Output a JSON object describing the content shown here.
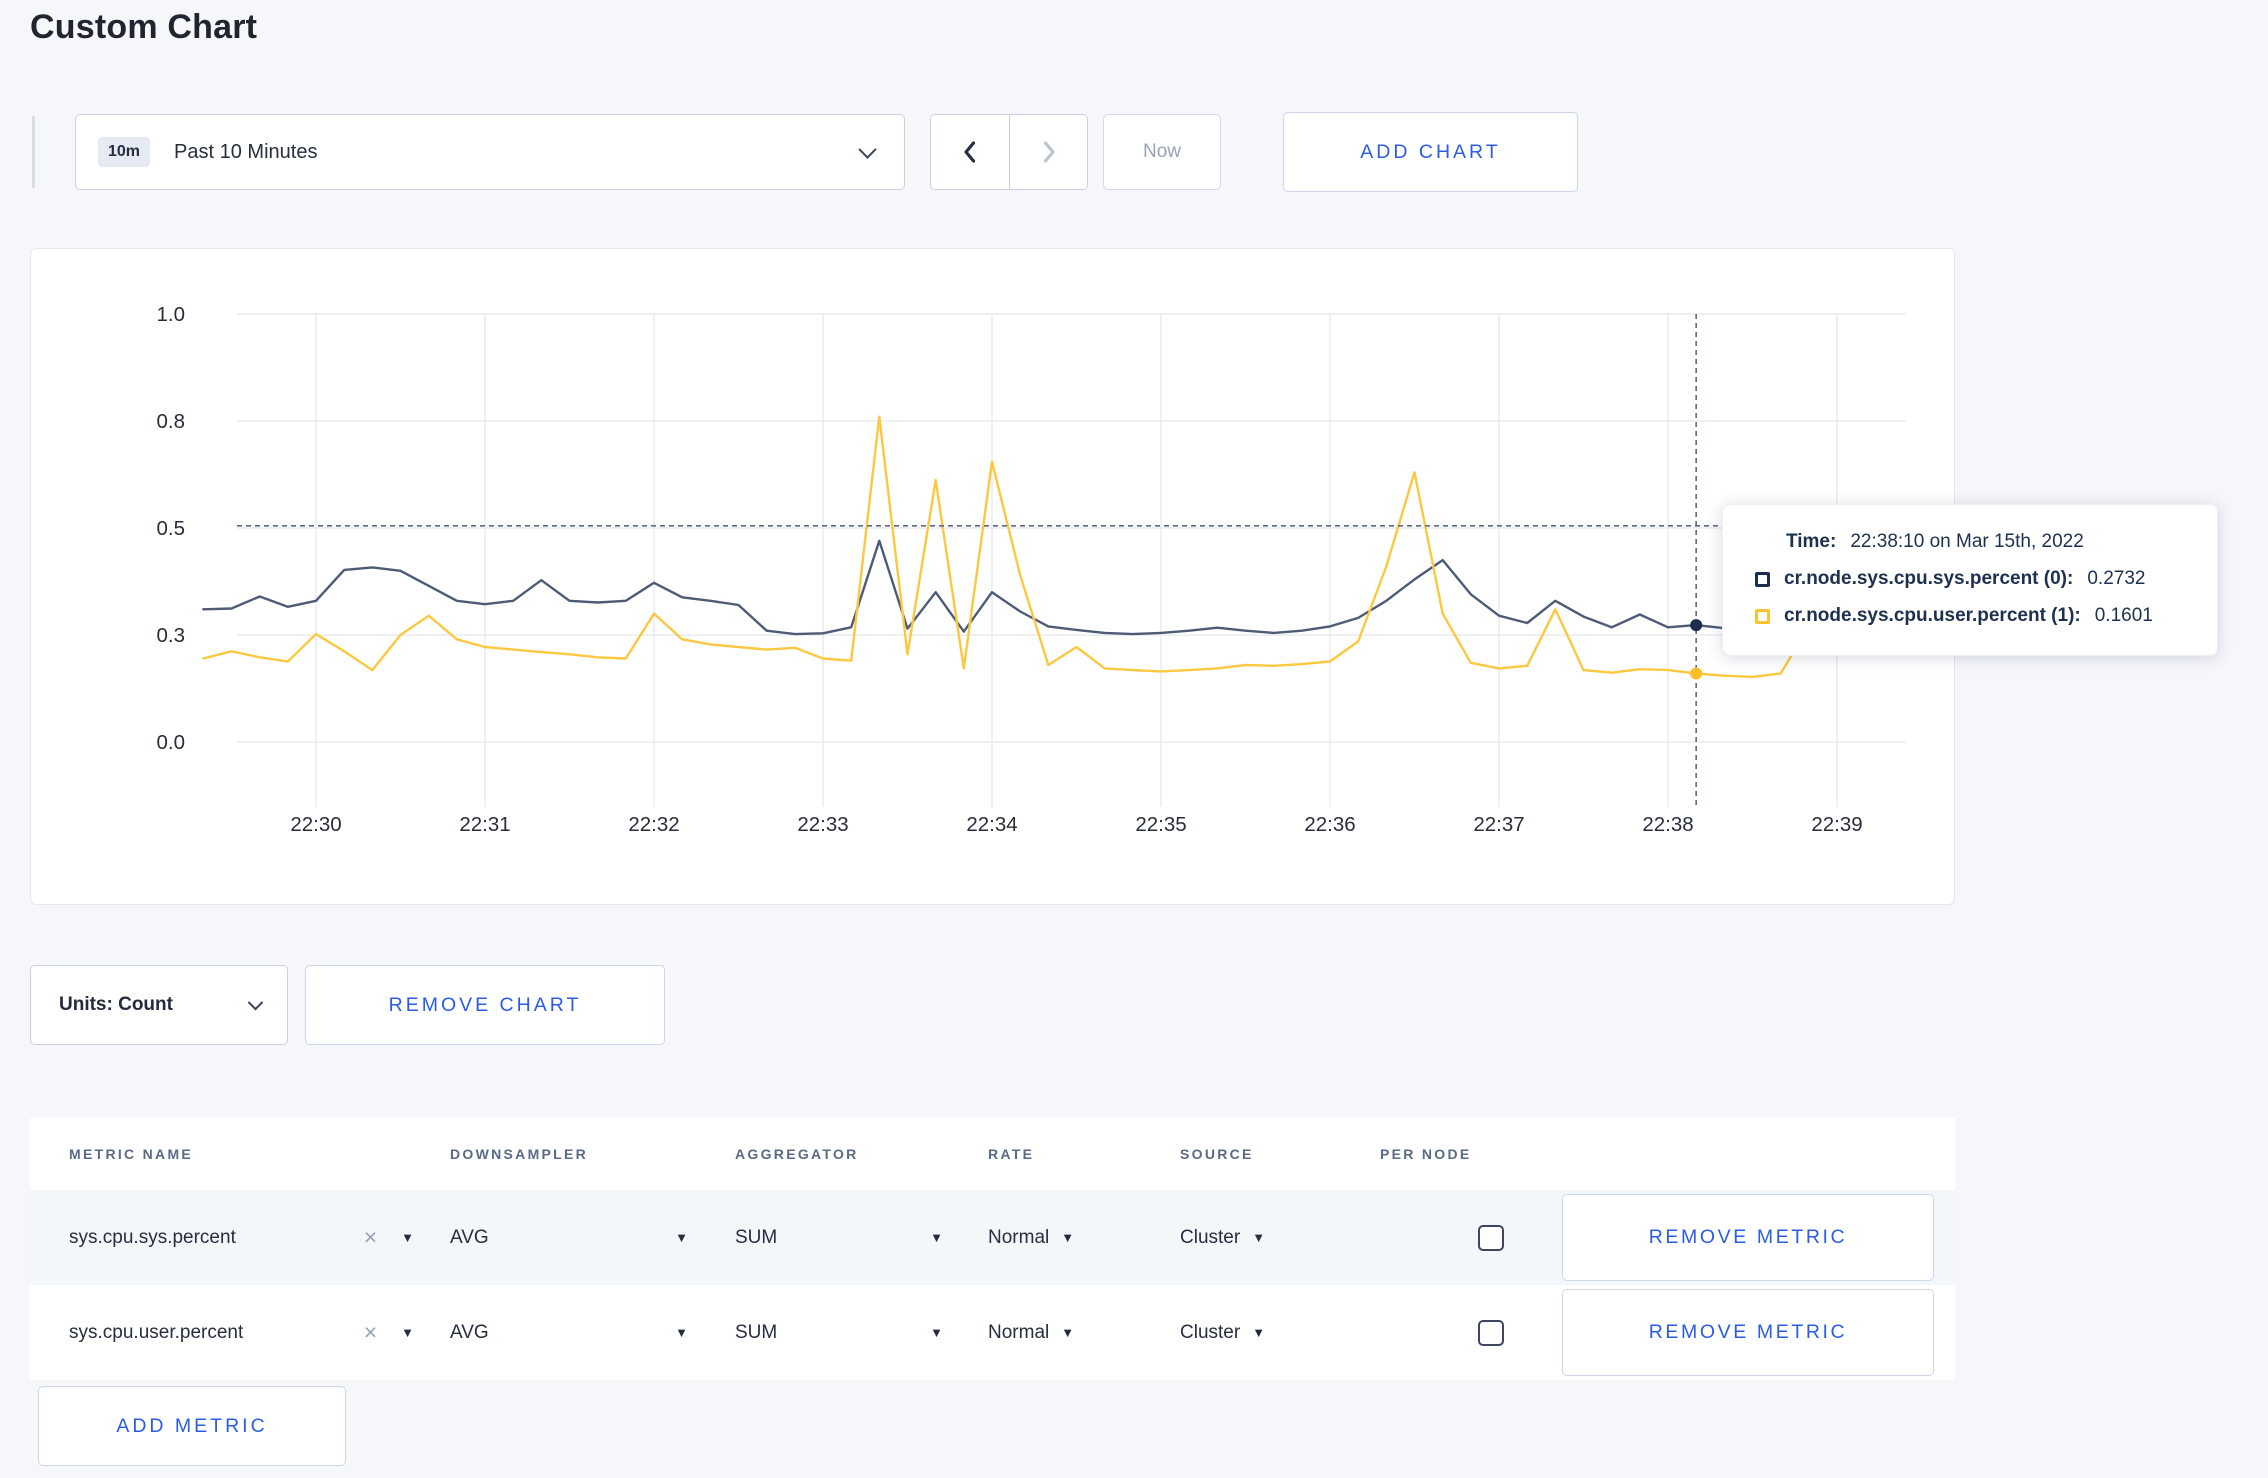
{
  "page": {
    "title": "Custom Chart",
    "accent": "#2b5ce7",
    "background": "#f5f7fb"
  },
  "toolbar": {
    "time_range": {
      "badge": "10m",
      "label": "Past 10 Minutes"
    },
    "now_label": "Now",
    "add_chart_label": "ADD CHART"
  },
  "units_bar": {
    "units_label": "Units: Count",
    "remove_chart_label": "REMOVE CHART"
  },
  "metrics_table": {
    "headers": [
      "METRIC NAME",
      "DOWNSAMPLER",
      "AGGREGATOR",
      "RATE",
      "SOURCE",
      "PER NODE"
    ],
    "rows": [
      {
        "metric": "sys.cpu.sys.percent",
        "downsampler": "AVG",
        "aggregator": "SUM",
        "rate": "Normal",
        "source": "Cluster",
        "per_node_checked": false,
        "remove_label": "REMOVE METRIC"
      },
      {
        "metric": "sys.cpu.user.percent",
        "downsampler": "AVG",
        "aggregator": "SUM",
        "rate": "Normal",
        "source": "Cluster",
        "per_node_checked": false,
        "remove_label": "REMOVE METRIC"
      }
    ],
    "add_metric_label": "ADD METRIC"
  },
  "chart_data": {
    "type": "line",
    "title": "",
    "xlabel": "",
    "ylabel": "",
    "ylim": [
      0,
      1
    ],
    "grid": true,
    "style": {
      "grid_color": "#e9ebf1",
      "crosshair_color": "#5a6a82",
      "tick_color": "#272d3a"
    },
    "y_axis": {
      "ticks": [
        {
          "value": 0.0,
          "label": "0.0"
        },
        {
          "value": 0.25,
          "label": "0.3"
        },
        {
          "value": 0.5,
          "label": "0.5"
        },
        {
          "value": 0.75,
          "label": "0.8"
        },
        {
          "value": 1.0,
          "label": "1.0"
        }
      ]
    },
    "x_axis": {
      "origin": "22:30:00",
      "ticks": [
        {
          "time": "22:30:00",
          "label": "22:30"
        },
        {
          "time": "22:31:00",
          "label": "22:31"
        },
        {
          "time": "22:32:00",
          "label": "22:32"
        },
        {
          "time": "22:33:00",
          "label": "22:33"
        },
        {
          "time": "22:34:00",
          "label": "22:34"
        },
        {
          "time": "22:35:00",
          "label": "22:35"
        },
        {
          "time": "22:36:00",
          "label": "22:36"
        },
        {
          "time": "22:37:00",
          "label": "22:37"
        },
        {
          "time": "22:38:00",
          "label": "22:38"
        },
        {
          "time": "22:39:00",
          "label": "22:39"
        }
      ]
    },
    "crosshair": {
      "time": "22:38:10",
      "y_value": 0.505
    },
    "series": [
      {
        "name": "cr.node.sys.cpu.sys.percent",
        "color": "#4d5b76",
        "dot_color": "#1d2c4f",
        "points": [
          [
            "22:29:20",
            0.31
          ],
          [
            "22:29:30",
            0.312
          ],
          [
            "22:29:40",
            0.34
          ],
          [
            "22:29:50",
            0.316
          ],
          [
            "22:30:00",
            0.33
          ],
          [
            "22:30:10",
            0.402
          ],
          [
            "22:30:20",
            0.408
          ],
          [
            "22:30:30",
            0.4
          ],
          [
            "22:30:40",
            0.365
          ],
          [
            "22:30:50",
            0.33
          ],
          [
            "22:31:00",
            0.322
          ],
          [
            "22:31:10",
            0.33
          ],
          [
            "22:31:20",
            0.378
          ],
          [
            "22:31:30",
            0.33
          ],
          [
            "22:31:40",
            0.326
          ],
          [
            "22:31:50",
            0.33
          ],
          [
            "22:32:00",
            0.372
          ],
          [
            "22:32:10",
            0.338
          ],
          [
            "22:32:20",
            0.33
          ],
          [
            "22:32:30",
            0.32
          ],
          [
            "22:32:40",
            0.26
          ],
          [
            "22:32:50",
            0.252
          ],
          [
            "22:33:00",
            0.254
          ],
          [
            "22:33:10",
            0.268
          ],
          [
            "22:33:20",
            0.47
          ],
          [
            "22:33:30",
            0.265
          ],
          [
            "22:33:40",
            0.35
          ],
          [
            "22:33:50",
            0.258
          ],
          [
            "22:34:00",
            0.35
          ],
          [
            "22:34:10",
            0.305
          ],
          [
            "22:34:20",
            0.27
          ],
          [
            "22:34:30",
            0.262
          ],
          [
            "22:34:40",
            0.255
          ],
          [
            "22:34:50",
            0.252
          ],
          [
            "22:35:00",
            0.255
          ],
          [
            "22:35:10",
            0.26
          ],
          [
            "22:35:20",
            0.267
          ],
          [
            "22:35:30",
            0.26
          ],
          [
            "22:35:40",
            0.255
          ],
          [
            "22:35:50",
            0.26
          ],
          [
            "22:36:00",
            0.27
          ],
          [
            "22:36:10",
            0.29
          ],
          [
            "22:36:20",
            0.33
          ],
          [
            "22:36:30",
            0.38
          ],
          [
            "22:36:40",
            0.425
          ],
          [
            "22:36:50",
            0.345
          ],
          [
            "22:37:00",
            0.295
          ],
          [
            "22:37:10",
            0.278
          ],
          [
            "22:37:20",
            0.33
          ],
          [
            "22:37:30",
            0.293
          ],
          [
            "22:37:40",
            0.268
          ],
          [
            "22:37:50",
            0.298
          ],
          [
            "22:38:00",
            0.268
          ],
          [
            "22:38:10",
            0.2732
          ],
          [
            "22:38:20",
            0.266
          ],
          [
            "22:38:30",
            0.278
          ],
          [
            "22:38:40",
            0.3
          ],
          [
            "22:38:50",
            0.288
          ],
          [
            "22:39:00",
            0.27
          ],
          [
            "22:39:10",
            0.298
          ],
          [
            "22:39:20",
            0.294
          ]
        ]
      },
      {
        "name": "cr.node.sys.cpu.user.percent",
        "color": "#fcc840",
        "dot_color": "#fcbd2a",
        "points": [
          [
            "22:29:20",
            0.195
          ],
          [
            "22:29:30",
            0.212
          ],
          [
            "22:29:40",
            0.198
          ],
          [
            "22:29:50",
            0.188
          ],
          [
            "22:30:00",
            0.252
          ],
          [
            "22:30:10",
            0.212
          ],
          [
            "22:30:20",
            0.168
          ],
          [
            "22:30:30",
            0.25
          ],
          [
            "22:30:40",
            0.295
          ],
          [
            "22:30:50",
            0.24
          ],
          [
            "22:31:00",
            0.222
          ],
          [
            "22:31:10",
            0.216
          ],
          [
            "22:31:20",
            0.21
          ],
          [
            "22:31:30",
            0.205
          ],
          [
            "22:31:40",
            0.198
          ],
          [
            "22:31:50",
            0.195
          ],
          [
            "22:32:00",
            0.3
          ],
          [
            "22:32:10",
            0.24
          ],
          [
            "22:32:20",
            0.228
          ],
          [
            "22:32:30",
            0.222
          ],
          [
            "22:32:40",
            0.216
          ],
          [
            "22:32:50",
            0.22
          ],
          [
            "22:33:00",
            0.195
          ],
          [
            "22:33:10",
            0.19
          ],
          [
            "22:33:20",
            0.76
          ],
          [
            "22:33:30",
            0.205
          ],
          [
            "22:33:40",
            0.612
          ],
          [
            "22:33:50",
            0.172
          ],
          [
            "22:34:00",
            0.655
          ],
          [
            "22:34:10",
            0.39
          ],
          [
            "22:34:20",
            0.18
          ],
          [
            "22:34:30",
            0.222
          ],
          [
            "22:34:40",
            0.172
          ],
          [
            "22:34:50",
            0.168
          ],
          [
            "22:35:00",
            0.165
          ],
          [
            "22:35:10",
            0.168
          ],
          [
            "22:35:20",
            0.172
          ],
          [
            "22:35:30",
            0.18
          ],
          [
            "22:35:40",
            0.178
          ],
          [
            "22:35:50",
            0.182
          ],
          [
            "22:36:00",
            0.188
          ],
          [
            "22:36:10",
            0.235
          ],
          [
            "22:36:20",
            0.41
          ],
          [
            "22:36:30",
            0.63
          ],
          [
            "22:36:40",
            0.3
          ],
          [
            "22:36:50",
            0.185
          ],
          [
            "22:37:00",
            0.172
          ],
          [
            "22:37:10",
            0.178
          ],
          [
            "22:37:20",
            0.31
          ],
          [
            "22:37:30",
            0.168
          ],
          [
            "22:37:40",
            0.162
          ],
          [
            "22:37:50",
            0.17
          ],
          [
            "22:38:00",
            0.168
          ],
          [
            "22:38:10",
            0.1601
          ],
          [
            "22:38:20",
            0.155
          ],
          [
            "22:38:30",
            0.152
          ],
          [
            "22:38:40",
            0.16
          ],
          [
            "22:38:50",
            0.27
          ],
          [
            "22:39:00",
            0.24
          ],
          [
            "22:39:10",
            0.225
          ],
          [
            "22:39:20",
            0.275
          ]
        ]
      }
    ],
    "tooltip": {
      "time_label": "Time:",
      "time_value": "22:38:10 on Mar 15th, 2022",
      "rows": [
        {
          "name": "cr.node.sys.cpu.sys.percent (0):",
          "value": "0.2732",
          "swatch_color": "#1d2c4f"
        },
        {
          "name": "cr.node.sys.cpu.user.percent (1):",
          "value": "0.1601",
          "swatch_color": "#fcc230"
        }
      ]
    }
  }
}
